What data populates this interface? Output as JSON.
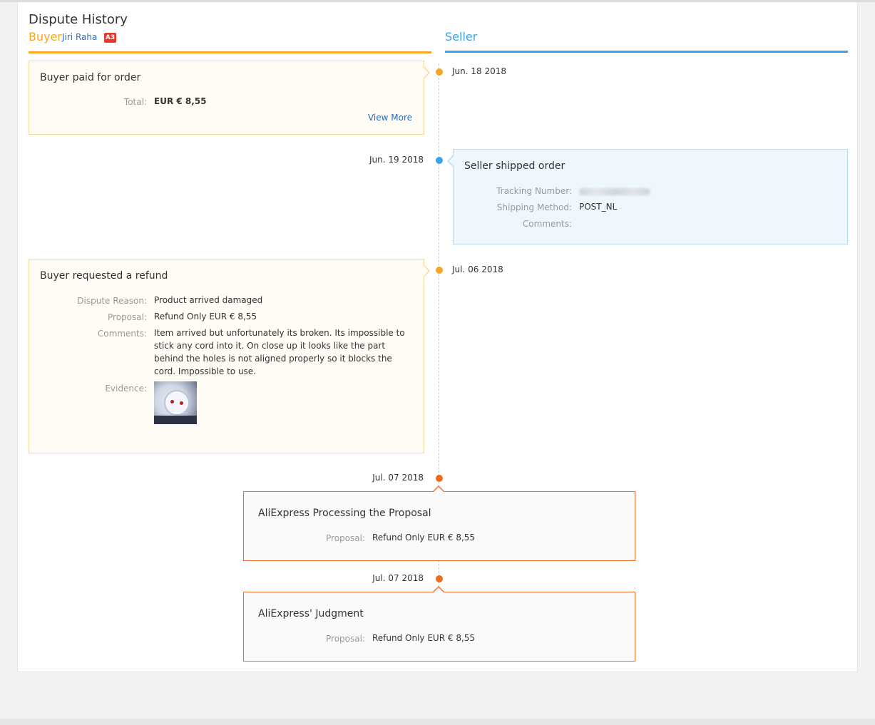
{
  "header": {
    "title": "Dispute History",
    "buyer_label": "Buyer",
    "buyer_name": "Jiri Raha",
    "buyer_level": "A3",
    "seller_label": "Seller"
  },
  "colors": {
    "buyer_accent": "#f5a623",
    "seller_accent": "#3aa3e3",
    "platform_accent": "#f26b1d"
  },
  "events": {
    "e1": {
      "date": "Jun. 18 2018",
      "title": "Buyer paid for order",
      "total_label": "Total:",
      "total_value": "EUR € 8,55",
      "link": "View More"
    },
    "e2": {
      "date": "Jun. 19 2018",
      "title": "Seller shipped order",
      "tracking_label": "Tracking Number:",
      "shipping_label": "Shipping Method:",
      "shipping_value": "POST_NL",
      "comments_label": "Comments:"
    },
    "e3": {
      "date": "Jul. 06 2018",
      "title": "Buyer requested a refund",
      "reason_label": "Dispute Reason:",
      "reason_value": "Product arrived damaged",
      "proposal_label": "Proposal:",
      "proposal_value": "Refund Only EUR € 8,55",
      "comments_label": "Comments:",
      "comments_value": "Item arrived but unfortunately its broken. Its impossible to stick any cord into it. On close up it looks like the part behind the holes is not aligned properly so it blocks the cord. Impossible to use.",
      "evidence_label": "Evidence:"
    },
    "e4": {
      "date": "Jul. 07 2018",
      "title": "AliExpress Processing the Proposal",
      "proposal_label": "Proposal:",
      "proposal_value": "Refund Only EUR € 8,55"
    },
    "e5": {
      "date": "Jul. 07 2018",
      "title": "AliExpress' Judgment",
      "proposal_label": "Proposal:",
      "proposal_value": "Refund Only EUR € 8,55"
    }
  }
}
